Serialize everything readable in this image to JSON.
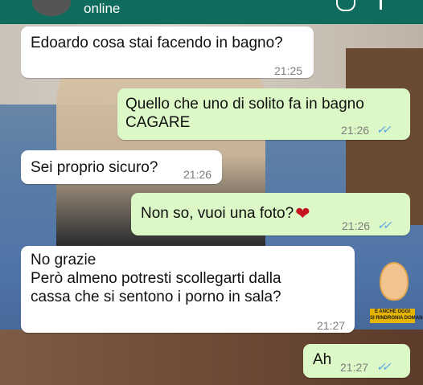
{
  "header": {
    "status": "online"
  },
  "messages": [
    {
      "direction": "incoming",
      "text": "Edoardo cosa stai facendo in bagno?",
      "time": "21:25"
    },
    {
      "direction": "outgoing",
      "text": "Quello che uno di solito fa in bagno\nCAGARE",
      "time": "21:26",
      "read": "✓✓"
    },
    {
      "direction": "incoming",
      "text": "Sei proprio sicuro?",
      "time": "21:26"
    },
    {
      "direction": "outgoing",
      "text": "Non so, vuoi una foto?",
      "emoji": "❤",
      "time": "21:26",
      "read": "✓✓"
    },
    {
      "direction": "incoming",
      "text": "No grazie\nPerò almeno potresti scollegarti dalla\ncassa che si sentono i porno in sala?",
      "time": "21:27"
    },
    {
      "direction": "outgoing",
      "text": "Ah",
      "time": "21:27",
      "read": "✓✓"
    }
  ],
  "watermark": {
    "text": "E ANCHE OGGI\nSI RINDRONIA DOMANI"
  },
  "colors": {
    "header": "#0f6b5c",
    "incoming": "#ffffff",
    "outgoing": "#dcf8c6",
    "tick": "#4fa3e6"
  }
}
